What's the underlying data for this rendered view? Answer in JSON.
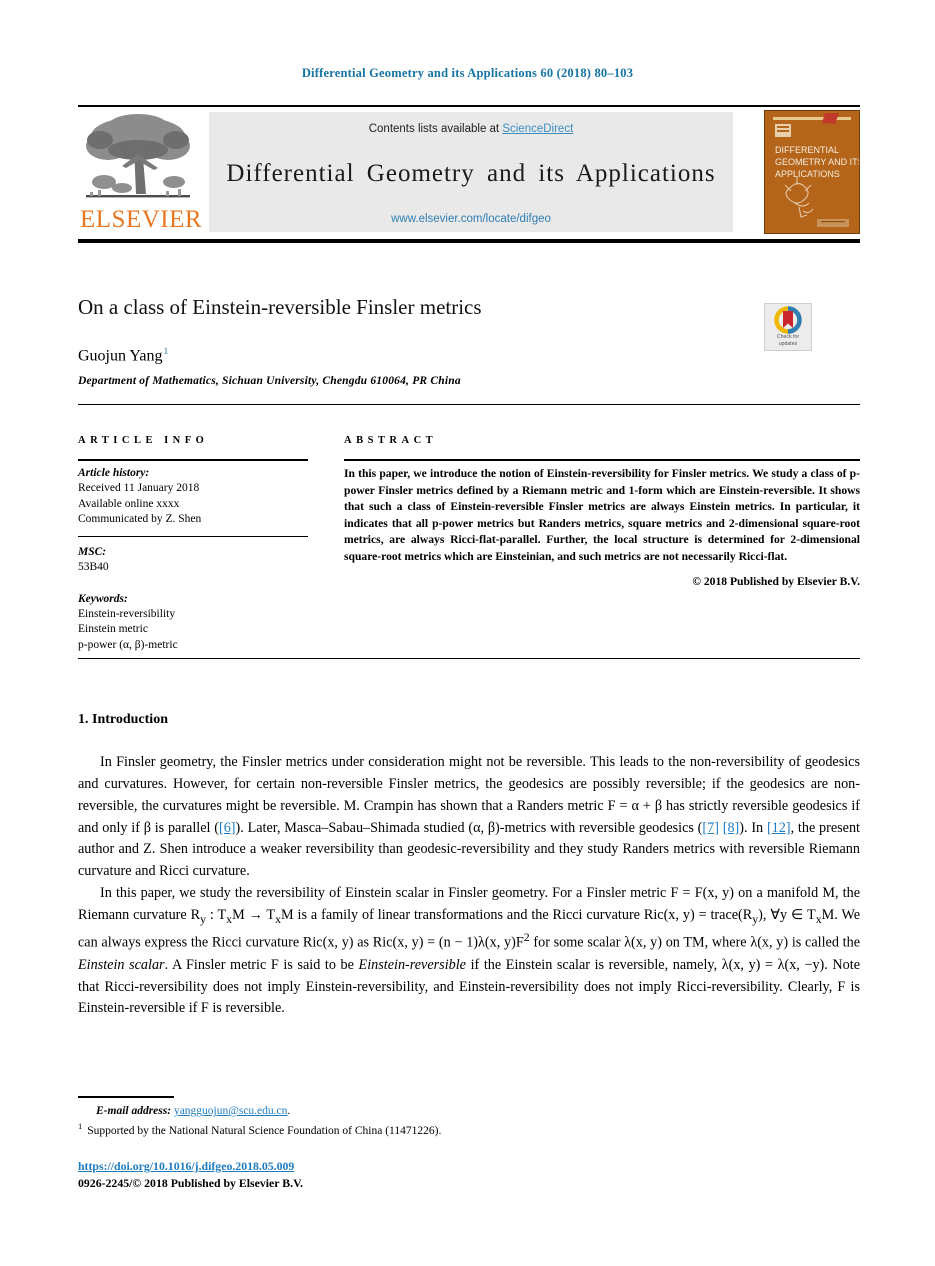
{
  "running_head": "Differential Geometry and its Applications 60 (2018) 80–103",
  "banner": {
    "publisher_logo_text": "ELSEVIER",
    "contents_prefix": "Contents lists available at ",
    "contents_link": "ScienceDirect",
    "journal_title": "Differential Geometry and its Applications",
    "journal_url": "www.elsevier.com/locate/difgeo",
    "cover": {
      "line1": "DIFFERENTIAL",
      "line2": "GEOMETRY AND ITS",
      "line3": "APPLICATIONS"
    }
  },
  "article": {
    "title": "On a class of Einstein-reversible Finsler metrics",
    "author": "Guojun Yang",
    "author_footnote_mark": "1",
    "affiliation": "Department of Mathematics, Sichuan University, Chengdu 610064, PR China",
    "crossmark": {
      "line1": "Check for",
      "line2": "updates"
    }
  },
  "info": {
    "heading": "ARTICLE INFO",
    "history_label": "Article history:",
    "received": "Received 11 January 2018",
    "available": "Available online xxxx",
    "communicated": "Communicated by Z. Shen",
    "msc_label": "MSC:",
    "msc_value": "53B40",
    "keywords_label": "Keywords:",
    "keyword1": "Einstein-reversibility",
    "keyword2": "Einstein metric",
    "keyword3": "p-power (α, β)-metric"
  },
  "abstract": {
    "heading": "ABSTRACT",
    "text": "In this paper, we introduce the notion of Einstein-reversibility for Finsler metrics. We study a class of p-power Finsler metrics defined by a Riemann metric and 1-form which are Einstein-reversible. It shows that such a class of Einstein-reversible Finsler metrics are always Einstein metrics. In particular, it indicates that all p-power metrics but Randers metrics, square metrics and 2-dimensional square-root metrics, are always Ricci-flat-parallel. Further, the local structure is determined for 2-dimensional square-root metrics which are Einsteinian, and such metrics are not necessarily Ricci-flat.",
    "copyright": "© 2018 Published by Elsevier B.V."
  },
  "body": {
    "section_number_title": "1. Introduction",
    "paragraph1_a": "In Finsler geometry, the Finsler metrics under consideration might not be reversible. This leads to the non-reversibility of geodesics and curvatures. However, for certain non-reversible Finsler metrics, the geodesics are possibly reversible; if the geodesics are non-reversible, the curvatures might be reversible. M. Crampin has shown that a Randers metric F = α + β has strictly reversible geodesics if and only if β is parallel (",
    "cite6": "[6]",
    "paragraph1_b": "). Later, Masca–Sabau–Shimada studied (α, β)-metrics with reversible geodesics (",
    "cite7": "[7]",
    "cite8": "[8]",
    "paragraph1_c": "). In ",
    "cite12": "[12]",
    "paragraph1_d": ", the present author and Z. Shen introduce a weaker reversibility than geodesic-reversibility and they study Randers metrics with reversible Riemann curvature and Ricci curvature.",
    "paragraph2_a": "In this paper, we study the reversibility of Einstein scalar in Finsler geometry. For a Finsler metric F = F(x, y) on a manifold M, the Riemann curvature R",
    "paragraph2_b": " : T",
    "paragraph2_c": "M → T",
    "paragraph2_d": "M is a family of linear transformations and the Ricci curvature Ric(x, y) = trace(R",
    "paragraph2_e": "), ∀y ∈ T",
    "paragraph2_f": "M. We can always express the Ricci curvature Ric(x, y) as Ric(x, y) = (n − 1)λ(x, y)F",
    "paragraph2_g": " for some scalar λ(x, y) on TM, where λ(x, y) is called the ",
    "paragraph2_em1": "Einstein scalar",
    "paragraph2_h": ". A Finsler metric F is said to be ",
    "paragraph2_em2": "Einstein-reversible",
    "paragraph2_i": " if the Einstein scalar is reversible, namely, λ(x, y) = λ(x, −y). Note that Ricci-reversibility does not imply Einstein-reversibility, and Einstein-reversibility does not imply Ricci-reversibility. Clearly, F is Einstein-reversible if F is reversible."
  },
  "footer": {
    "email_label": "E-mail address:",
    "email": "yangguojun@scu.edu.cn",
    "email_period": ".",
    "footnote_mark": "1",
    "footnote_text": "Supported by the National Natural Science Foundation of China (11471226).",
    "doi": "https://doi.org/10.1016/j.difgeo.2018.05.009",
    "issn_line": "0926-2245/© 2018 Published by Elsevier B.V."
  },
  "colors": {
    "link_blue": "#1f7cc0",
    "header_blue": "#1574a4",
    "sciencedirect_blue": "#3b8ec2",
    "elsevier_orange": "#e87722",
    "cover_orange": "#b4651a"
  }
}
